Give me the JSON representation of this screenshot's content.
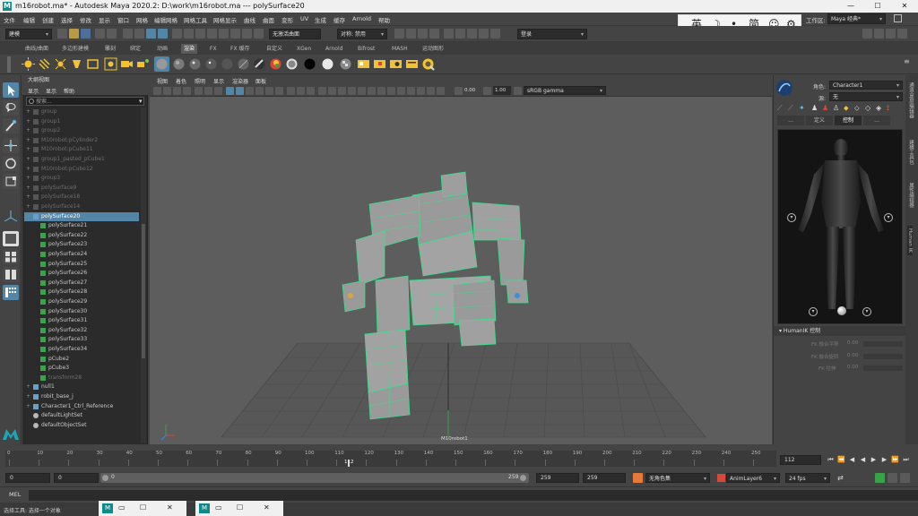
{
  "window": {
    "logo": "M",
    "title": "m16robot.ma* - Autodesk Maya 2020.2: D:\\work\\m16robot.ma  ---  polySurface20",
    "min": "—",
    "max": "☐",
    "close": "✕"
  },
  "menubar": [
    "文件",
    "编辑",
    "创建",
    "选择",
    "修改",
    "显示",
    "窗口",
    "网格",
    "编辑网格",
    "网格工具",
    "网格显示",
    "曲线",
    "曲面",
    "变形",
    "UV",
    "生成",
    "缓存",
    "Arnold",
    "帮助"
  ],
  "workspace": {
    "label": "工作区:",
    "value": "Maya 经典*"
  },
  "status_line": {
    "mode": "建模",
    "live_surface": "无激活曲面",
    "symmetry": "对称: 禁用",
    "login": "登录"
  },
  "ime": {
    "lang": "英",
    "moon": "☽",
    "punct": "•,",
    "simp": "简",
    "emoji": "☺",
    "settings": "⚙"
  },
  "shelf_tabs": [
    "曲线/曲面",
    "多边形建模",
    "雕刻",
    "绑定",
    "动画",
    "渲染",
    "FX",
    "FX 缓存",
    "自定义",
    "XGen",
    "Arnold",
    "Bifrost",
    "MASH",
    "运动图形"
  ],
  "shelf_active_tab": "渲染",
  "outliner": {
    "title": "大纲视图",
    "menu": [
      "显示",
      "显示",
      "帮助"
    ],
    "search_placeholder": "搜索...",
    "rows": [
      {
        "label": "group",
        "depth": 0,
        "dim": true,
        "expander": "+"
      },
      {
        "label": "group1",
        "depth": 0,
        "dim": true,
        "expander": "+"
      },
      {
        "label": "group2",
        "depth": 0,
        "dim": true,
        "expander": "+"
      },
      {
        "label": "M10robot:pCylinder2",
        "depth": 0,
        "dim": true,
        "expander": "+"
      },
      {
        "label": "M10robot:pCube11",
        "depth": 0,
        "dim": true,
        "expander": "+"
      },
      {
        "label": "group1_pasted_pCube1",
        "depth": 0,
        "dim": true,
        "expander": "+"
      },
      {
        "label": "M10robot:pCube12",
        "depth": 0,
        "dim": true,
        "expander": "+"
      },
      {
        "label": "group3",
        "depth": 0,
        "dim": true,
        "expander": "+"
      },
      {
        "label": "polySurface9",
        "depth": 0,
        "dim": true,
        "expander": "+"
      },
      {
        "label": "polySurface18",
        "depth": 0,
        "dim": true,
        "expander": "+"
      },
      {
        "label": "polySurface14",
        "depth": 0,
        "dim": true,
        "expander": "+"
      },
      {
        "label": "polySurface20",
        "depth": 0,
        "dim": false,
        "expander": "−",
        "selected": true
      },
      {
        "label": "polySurface21",
        "depth": 1,
        "dim": false,
        "expander": ""
      },
      {
        "label": "polySurface22",
        "depth": 1,
        "dim": false,
        "expander": ""
      },
      {
        "label": "polySurface23",
        "depth": 1,
        "dim": false,
        "expander": ""
      },
      {
        "label": "polySurface24",
        "depth": 1,
        "dim": false,
        "expander": ""
      },
      {
        "label": "polySurface25",
        "depth": 1,
        "dim": false,
        "expander": ""
      },
      {
        "label": "polySurface26",
        "depth": 1,
        "dim": false,
        "expander": ""
      },
      {
        "label": "polySurface27",
        "depth": 1,
        "dim": false,
        "expander": ""
      },
      {
        "label": "polySurface28",
        "depth": 1,
        "dim": false,
        "expander": ""
      },
      {
        "label": "polySurface29",
        "depth": 1,
        "dim": false,
        "expander": ""
      },
      {
        "label": "polySurface30",
        "depth": 1,
        "dim": false,
        "expander": ""
      },
      {
        "label": "polySurface31",
        "depth": 1,
        "dim": false,
        "expander": ""
      },
      {
        "label": "polySurface32",
        "depth": 1,
        "dim": false,
        "expander": ""
      },
      {
        "label": "polySurface33",
        "depth": 1,
        "dim": false,
        "expander": ""
      },
      {
        "label": "polySurface34",
        "depth": 1,
        "dim": false,
        "expander": ""
      },
      {
        "label": "pCube2",
        "depth": 1,
        "dim": false,
        "expander": ""
      },
      {
        "label": "pCube3",
        "depth": 1,
        "dim": false,
        "expander": ""
      },
      {
        "label": "transform28",
        "depth": 1,
        "dim": true,
        "expander": ""
      },
      {
        "label": "null1",
        "depth": 0,
        "dim": false,
        "expander": "+"
      },
      {
        "label": "robit_base_j",
        "depth": 0,
        "dim": false,
        "expander": "+"
      },
      {
        "label": "Character1_Ctrl_Reference",
        "depth": 0,
        "dim": false,
        "expander": "+"
      },
      {
        "label": "defaultLightSet",
        "depth": 0,
        "dim": false,
        "expander": ""
      },
      {
        "label": "defaultObjectSet",
        "depth": 0,
        "dim": false,
        "expander": ""
      }
    ]
  },
  "viewport": {
    "menu": [
      "视图",
      "着色",
      "照明",
      "显示",
      "渲染器",
      "面板"
    ],
    "near_value": "0.00",
    "far_value": "1.00",
    "color_space": "sRGB gamma",
    "camera_label": "M10robot1"
  },
  "humanik": {
    "char_label": "角色:",
    "char_value": "Character1",
    "source_label": "源:",
    "source_value": "无",
    "tabs": [
      "...",
      "定义",
      "控制",
      "..."
    ],
    "active_tab": "控制",
    "section": "HumanIK 控制",
    "props": [
      {
        "label": "FK 融合平移",
        "value": "0.00"
      },
      {
        "label": "FK 融合旋转",
        "value": "0.00"
      },
      {
        "label": "FK 拉伸",
        "value": "0.00"
      }
    ]
  },
  "side_tabs": [
    "通道盒/层编辑器",
    "建模工具包",
    "属性编辑器",
    "Human IK"
  ],
  "timeline": {
    "ticks": [
      "0",
      "10",
      "20",
      "30",
      "40",
      "50",
      "60",
      "70",
      "80",
      "90",
      "100",
      "110",
      "120",
      "130",
      "140",
      "150",
      "160",
      "170",
      "180",
      "190",
      "200",
      "210",
      "220",
      "230",
      "240",
      "250"
    ],
    "current_frame": "112",
    "current_label": "112"
  },
  "range": {
    "start": "0",
    "start2": "0",
    "range_start": "0",
    "range_end": "259",
    "end1": "259",
    "end2": "259",
    "character_set": "无角色集",
    "anim_layer": "AnimLayer6",
    "fps": "24 fps"
  },
  "cmdline": {
    "label": "MEL"
  },
  "helpline": {
    "text": "选择工具: 选择一个对象"
  },
  "minimized": [
    {
      "logo": "M",
      "b1": "▭",
      "b2": "☐",
      "b3": "✕"
    },
    {
      "logo": "M",
      "b1": "▭",
      "b2": "☐",
      "b3": "✕"
    }
  ]
}
